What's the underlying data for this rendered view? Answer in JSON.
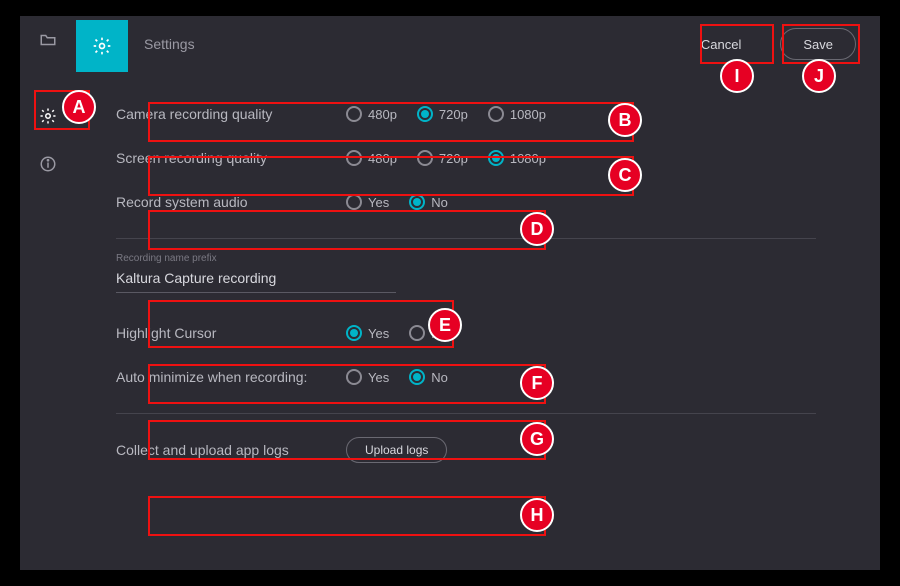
{
  "header": {
    "title": "Settings",
    "cancel": "Cancel",
    "save": "Save"
  },
  "sidebar": {
    "icons": [
      "folder",
      "gear",
      "info"
    ]
  },
  "settings": {
    "camera_quality": {
      "label": "Camera recording quality",
      "options": [
        "480p",
        "720p",
        "1080p"
      ],
      "selected": "720p"
    },
    "screen_quality": {
      "label": "Screen recording quality",
      "options": [
        "480p",
        "720p",
        "1080p"
      ],
      "selected": "1080p"
    },
    "system_audio": {
      "label": "Record system audio",
      "options": [
        "Yes",
        "No"
      ],
      "selected": "No"
    },
    "prefix": {
      "label": "Recording name prefix",
      "value": "Kaltura Capture recording"
    },
    "highlight_cursor": {
      "label": "Highlight Cursor",
      "options": [
        "Yes",
        "No"
      ],
      "selected": "Yes"
    },
    "auto_minimize": {
      "label": "Auto minimize when recording:",
      "options": [
        "Yes",
        "No"
      ],
      "selected": "No"
    },
    "logs": {
      "label": "Collect and upload app logs",
      "button": "Upload logs"
    }
  },
  "annotations": {
    "A": "A",
    "B": "B",
    "C": "C",
    "D": "D",
    "E": "E",
    "F": "F",
    "G": "G",
    "H": "H",
    "I": "I",
    "J": "J"
  }
}
